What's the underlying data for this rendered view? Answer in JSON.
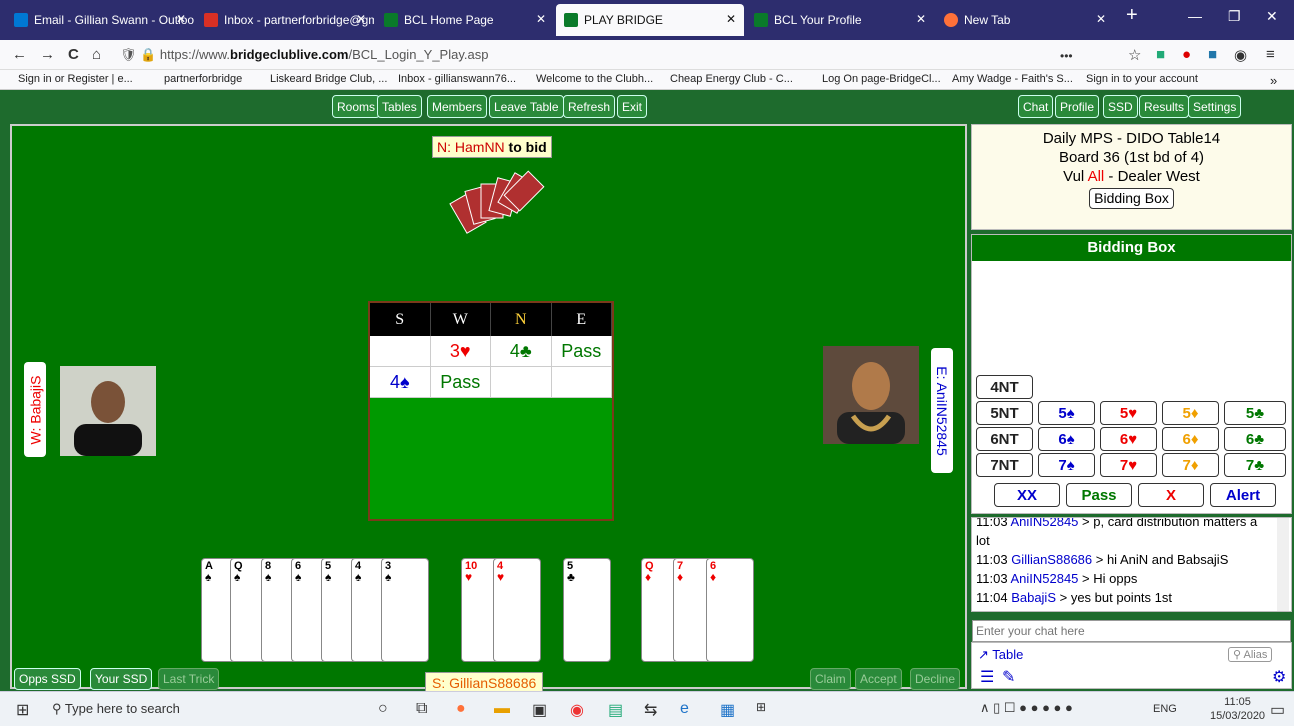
{
  "tabs": [
    {
      "label": "Email - Gillian Swann - Outloo",
      "color": "#0078d4"
    },
    {
      "label": "Inbox - partnerforbridge@gm",
      "color": "#d93025"
    },
    {
      "label": "BCL Home Page",
      "color": "#0a7a2a"
    },
    {
      "label": "PLAY BRIDGE",
      "color": "#0a7a2a"
    },
    {
      "label": "BCL Your Profile",
      "color": "#0a7a2a"
    },
    {
      "label": "New Tab",
      "color": "#ff7139"
    }
  ],
  "nav": {
    "url_pre": "https://www.",
    "url_host": "bridgeclublive.com",
    "url_path": "/BCL_Login_Y_Play.asp",
    "back": "←",
    "forward": "→",
    "reload": "C",
    "home": "⌂",
    "dots": "•••",
    "menu": "≡"
  },
  "bookmarks": [
    "Sign in or Register | e...",
    "partnerforbridge",
    "Liskeard Bridge Club, ...",
    "Inbox - gillianswann76...",
    "Welcome to the Clubh...",
    "Cheap Energy Club - C...",
    "Log On page-BridgeCl...",
    "Amy Wadge - Faith's S...",
    "Sign in to your account"
  ],
  "top_buttons": [
    "Rooms",
    "Tables",
    "Members",
    "Leave Table",
    "Refresh",
    "Exit"
  ],
  "right_buttons": [
    "Chat",
    "Profile",
    "SSD",
    "Results",
    "Settings"
  ],
  "north": {
    "prefix": "N: ",
    "name": "HamNN",
    "suffix": " to bid"
  },
  "west": {
    "label": "W: BabajiS"
  },
  "east": {
    "label": "E: AniIN52845"
  },
  "south": {
    "label": "S: GillianS88686"
  },
  "auction": {
    "headers": [
      "S",
      "W",
      "N",
      "E"
    ],
    "row1": [
      "",
      "3♥",
      "4♣",
      "Pass"
    ],
    "row2": [
      "4♠",
      "Pass",
      "",
      ""
    ]
  },
  "hand": [
    {
      "rank": "A",
      "suit": "♠",
      "color": "#000"
    },
    {
      "rank": "Q",
      "suit": "♠",
      "color": "#000"
    },
    {
      "rank": "8",
      "suit": "♠",
      "color": "#000"
    },
    {
      "rank": "6",
      "suit": "♠",
      "color": "#000"
    },
    {
      "rank": "5",
      "suit": "♠",
      "color": "#000"
    },
    {
      "rank": "4",
      "suit": "♠",
      "color": "#000"
    },
    {
      "rank": "3",
      "suit": "♠",
      "color": "#000"
    },
    {
      "rank": "10",
      "suit": "♥",
      "color": "#e00"
    },
    {
      "rank": "4",
      "suit": "♥",
      "color": "#e00"
    },
    {
      "rank": "5",
      "suit": "♣",
      "color": "#000"
    },
    {
      "rank": "Q",
      "suit": "♦",
      "color": "#e00"
    },
    {
      "rank": "7",
      "suit": "♦",
      "color": "#e00"
    },
    {
      "rank": "6",
      "suit": "♦",
      "color": "#e00"
    }
  ],
  "bottom_left_buttons": [
    "Opps SSD",
    "Your SSD",
    "Last Trick"
  ],
  "bottom_right_buttons": [
    "Claim",
    "Accept",
    "Decline"
  ],
  "info": {
    "line1": "Daily MPS - DIDO Table14",
    "line2": "Board 36 (1st bd of 4)",
    "vul_pre": "Vul ",
    "vul": "All",
    "vul_post": " - Dealer West",
    "button": "Bidding Box"
  },
  "bidbox": {
    "title": "Bidding Box",
    "row0": [
      "4NT"
    ],
    "row1": [
      "5NT",
      "5♠",
      "5♥",
      "5♦",
      "5♣"
    ],
    "row2": [
      "6NT",
      "6♠",
      "6♥",
      "6♦",
      "6♣"
    ],
    "row3": [
      "7NT",
      "7♠",
      "7♥",
      "7♦",
      "7♣"
    ],
    "actions": [
      "XX",
      "Pass",
      "X",
      "Alert"
    ]
  },
  "chat": [
    {
      "time": "11:03 ",
      "user": "AniIN52845",
      "msg": " > p, card distribution matters a"
    },
    {
      "time": "",
      "user": "",
      "msg": "lot"
    },
    {
      "time": "11:03 ",
      "user": "GillianS88686",
      "msg": " > hi AniN and BabsajiS"
    },
    {
      "time": "11:03 ",
      "user": "AniIN52845",
      "msg": " > Hi opps"
    },
    {
      "time": "11:04 ",
      "user": "BabajiS",
      "msg": " > yes but points 1st"
    }
  ],
  "chat_input_placeholder": "Enter your chat here",
  "chat_table_link": "Table",
  "alias": "Alias",
  "taskbar": {
    "search": "Type here to search",
    "lang": "ENG",
    "time": "11:05",
    "date": "15/03/2020"
  }
}
